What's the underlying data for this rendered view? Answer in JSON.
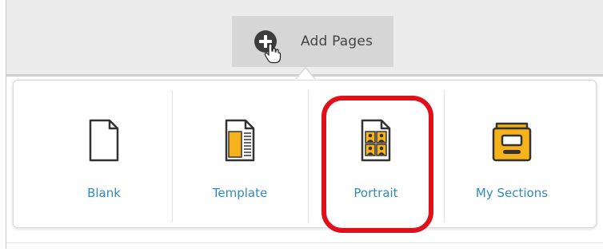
{
  "toolbar": {
    "add_pages_label": "Add Pages",
    "add_pages_icon": "plus-circle-icon"
  },
  "page_options": [
    {
      "label": "Blank",
      "icon": "blank-page-icon"
    },
    {
      "label": "Template",
      "icon": "template-page-icon"
    },
    {
      "label": "Portrait",
      "icon": "portrait-page-icon",
      "highlighted": true
    },
    {
      "label": "My Sections",
      "icon": "folder-icon"
    }
  ],
  "colors": {
    "label_blue": "#2f8bb8",
    "highlight_red": "#e0101a",
    "icon_yellow": "#f6b21b"
  }
}
